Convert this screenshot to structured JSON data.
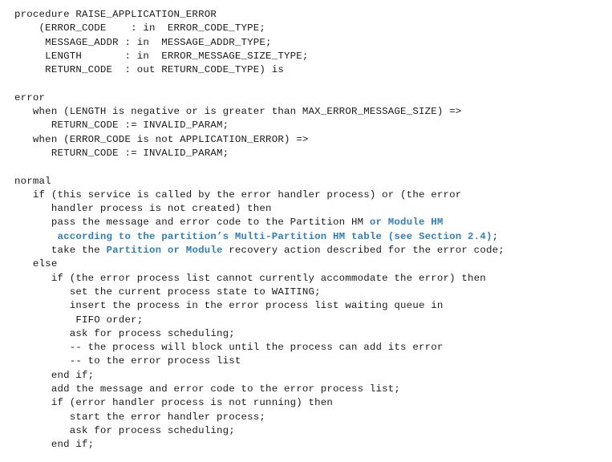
{
  "pseudocode": {
    "header": [
      "procedure RAISE_APPLICATION_ERROR",
      "    (ERROR_CODE    : in  ERROR_CODE_TYPE;",
      "     MESSAGE_ADDR : in  MESSAGE_ADDR_TYPE;",
      "     LENGTH       : in  ERROR_MESSAGE_SIZE_TYPE;",
      "     RETURN_CODE  : out RETURN_CODE_TYPE) is"
    ],
    "error_section": [
      "error",
      "   when (LENGTH is negative or is greater than MAX_ERROR_MESSAGE_SIZE) =>",
      "      RETURN_CODE := INVALID_PARAM;",
      "   when (ERROR_CODE is not APPLICATION_ERROR) =>",
      "      RETURN_CODE := INVALID_PARAM;"
    ],
    "normal_section": {
      "l1": "normal",
      "l2": "   if (this service is called by the error handler process) or (the error",
      "l3": "      handler process is not created) then",
      "l4a": "      pass the message and error code to the Partition HM ",
      "l4b": "or Module HM",
      "l5": "       according to the partition’s Multi-Partition HM table (see Section 2.4)",
      "l5end": ";",
      "l6a": "      take the ",
      "l6b": "Partition or Module",
      "l6c": " recovery action described for the error code;",
      "l7": "   else",
      "rest": [
        "      if (the error process list cannot currently accommodate the error) then",
        "         set the current process state to WAITING;",
        "         insert the process in the error process list waiting queue in",
        "          FIFO order;",
        "         ask for process scheduling;",
        "         -- the process will block until the process can add its error",
        "         -- to the error process list",
        "      end if;",
        "      add the message and error code to the error process list;",
        "      if (error handler process is not running) then",
        "         start the error handler process;",
        "         ask for process scheduling;",
        "      end if;"
      ]
    },
    "highlight_color": "#2f7fc1"
  }
}
